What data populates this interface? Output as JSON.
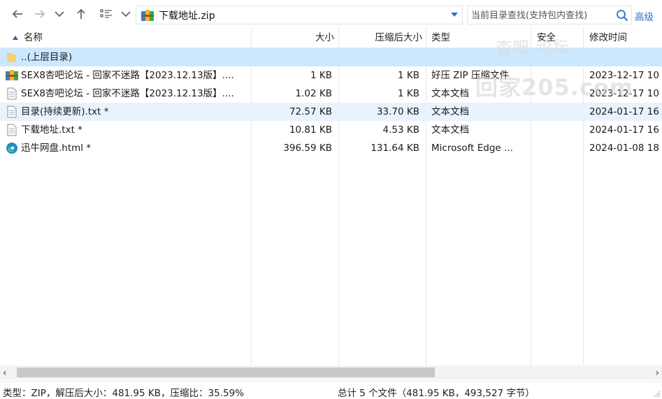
{
  "toolbar": {
    "path": "下载地址.zip",
    "search_placeholder": "当前目录查找(支持包内查找)",
    "advanced_label": "高级"
  },
  "columns": {
    "name": "名称",
    "size": "大小",
    "compressed": "压缩后大小",
    "type": "类型",
    "security": "安全",
    "modified": "修改时间"
  },
  "rows": [
    {
      "icon": "folder-icon",
      "name": "..(上层目录)",
      "size": "",
      "compressed": "",
      "type": "",
      "modified": ""
    },
    {
      "icon": "zip-archive-icon",
      "name": "SEX8杏吧论坛 - 回家不迷路【2023.12.13版】....",
      "size": "1 KB",
      "compressed": "1 KB",
      "type": "好压 ZIP 压缩文件",
      "modified": "2023-12-17 10"
    },
    {
      "icon": "text-file-icon",
      "name": "SEX8杏吧论坛 - 回家不迷路【2023.12.13版】....",
      "size": "1.02 KB",
      "compressed": "1 KB",
      "type": "文本文档",
      "modified": "2023-12-17 10"
    },
    {
      "icon": "text-file-icon",
      "name": "目录(持续更新).txt *",
      "size": "72.57 KB",
      "compressed": "33.70 KB",
      "type": "文本文档",
      "modified": "2024-01-17 16"
    },
    {
      "icon": "text-file-icon",
      "name": "下载地址.txt *",
      "size": "10.81 KB",
      "compressed": "4.53 KB",
      "type": "文本文档",
      "modified": "2024-01-17 16"
    },
    {
      "icon": "edge-icon",
      "name": "迅牛网盘.html *",
      "size": "396.59 KB",
      "compressed": "131.64 KB",
      "type": "Microsoft Edge ...",
      "modified": "2024-01-08 18"
    }
  ],
  "watermark": {
    "line1": "杏吧  论坛",
    "line2": "回家205.com"
  },
  "statusbar": {
    "left": "类型：ZIP，解压后大小：481.95 KB，压缩比：35.59%",
    "right": "总计 5 个文件（481.95 KB，493,527 字节）"
  },
  "colors": {
    "accent": "#2d6fd6",
    "selected_row": "#cce8ff",
    "alt_row": "#e8f3fd"
  }
}
